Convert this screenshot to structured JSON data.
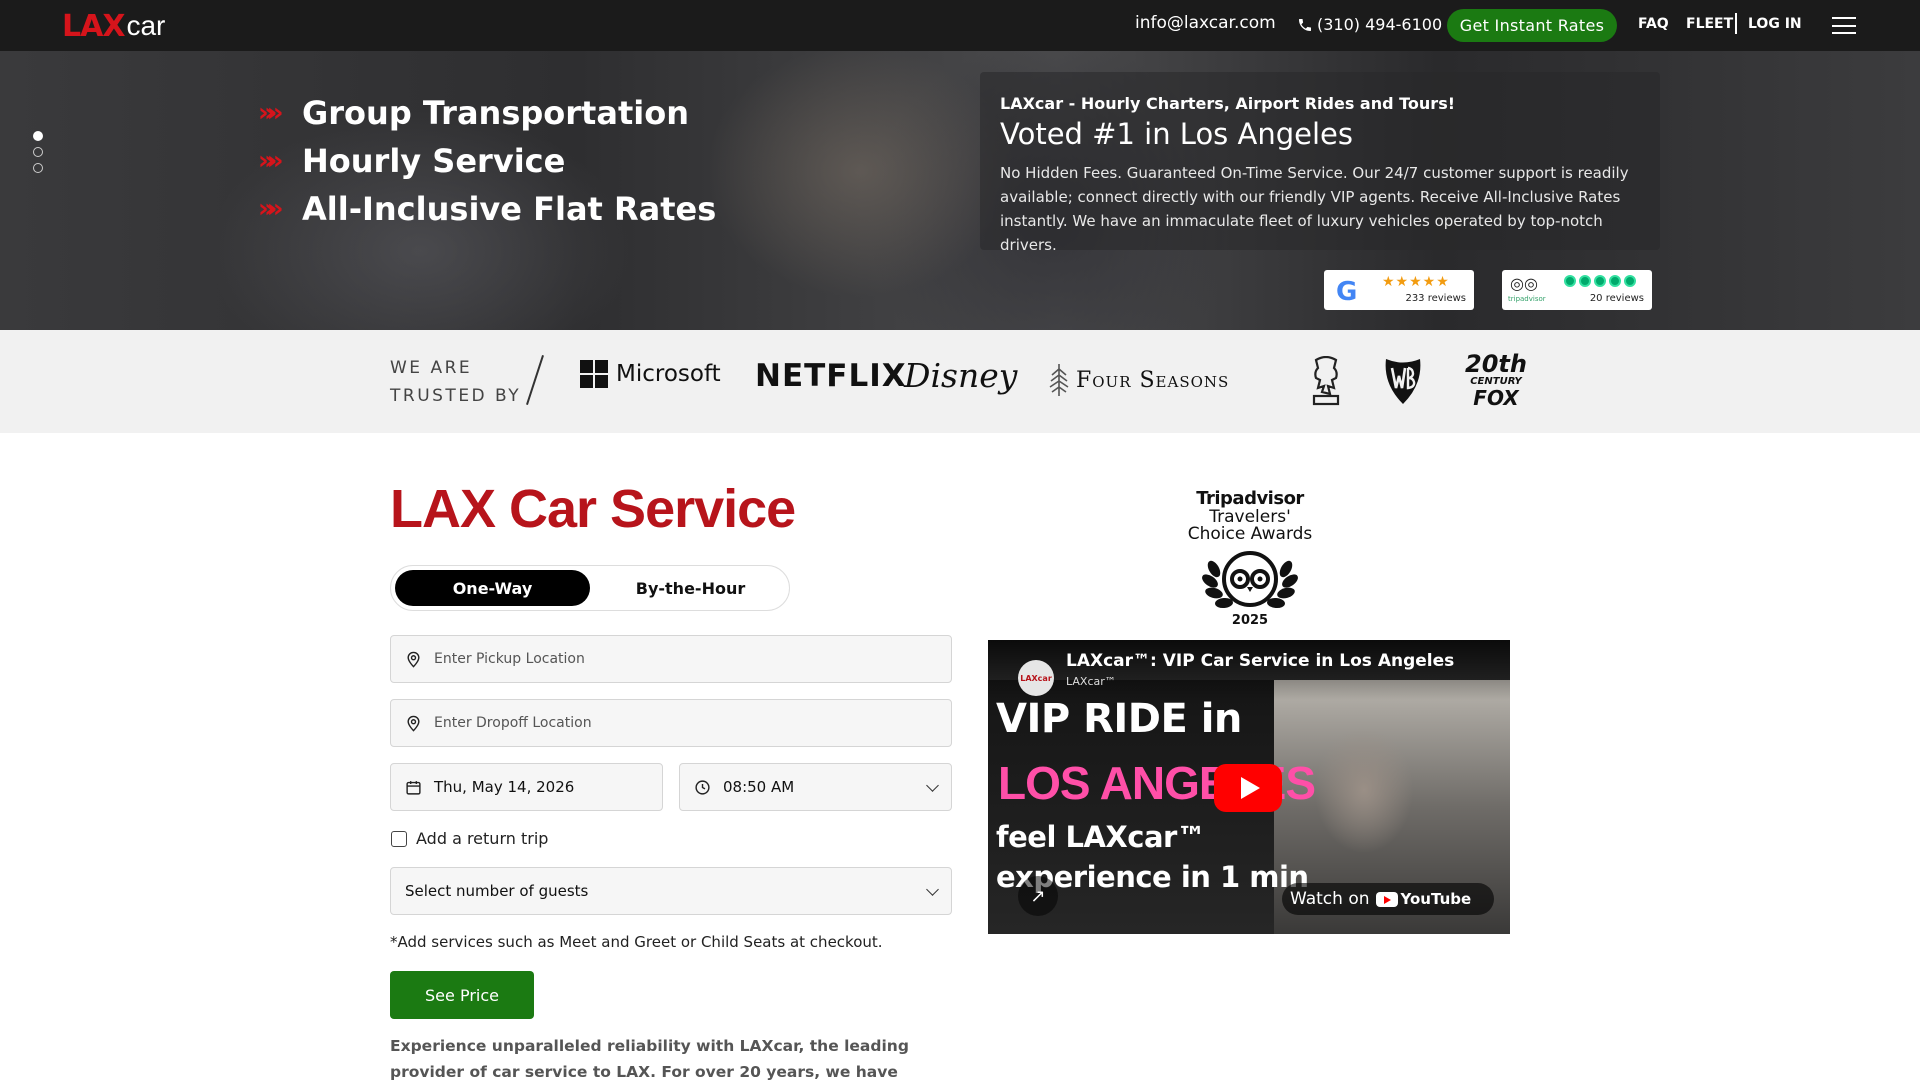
{
  "header": {
    "logo_lax": "LAX",
    "logo_car": "car",
    "email": "info@laxcar.com",
    "phone": "(310) 494-6100",
    "cta_label": "Get Instant Rates",
    "nav": {
      "faq": "FAQ",
      "fleet": "FLEET",
      "login": "LOG IN"
    }
  },
  "hero": {
    "bullets": [
      "Group Transportation",
      "Hourly Service",
      "All-Inclusive Flat Rates"
    ],
    "bullet_marker": "»»",
    "carousel_active_index": 0,
    "promo": {
      "subtitle": "LAXcar - Hourly Charters, Airport Rides and Tours!",
      "headline": "Voted #1 in Los Angeles",
      "description": "No Hidden Fees. Guaranteed On-Time Service. Our 24/7 customer support is readily available; connect directly with our friendly VIP agents. Receive All-Inclusive Rates instantly. We have an immaculate fleet of luxury vehicles operated by top-notch drivers."
    },
    "reviews": {
      "google": {
        "logo": "G",
        "rating": 5,
        "stars": "★★★★★",
        "count_label": "233 reviews"
      },
      "tripadvisor": {
        "logo": "◎◎",
        "wordmark": "tripadvisor",
        "rating": 5,
        "count_label": "20 reviews"
      }
    }
  },
  "trusted": {
    "label_line1": "WE ARE",
    "label_line2": "TRUSTED BY",
    "brands": {
      "microsoft": "Microsoft",
      "netflix": "NETFLIX",
      "disney": "Disney",
      "four_seasons": "Four Seasons",
      "fox_line1": "20th",
      "fox_line2": "CENTURY",
      "fox_line3": "FOX"
    }
  },
  "booking": {
    "title": "LAX Car Service",
    "modes": {
      "one_way": "One-Way",
      "by_hour": "By-the-Hour",
      "active": "One-Way"
    },
    "pickup_placeholder": "Enter Pickup Location",
    "dropoff_placeholder": "Enter Dropoff Location",
    "date_value": "Thu, May 14, 2026",
    "time_value": "08:50 AM",
    "return_trip_label": "Add a return trip",
    "guests_placeholder": "Select number of guests",
    "note": "*Add services such as Meet and Greet or Child Seats at checkout.",
    "submit_label": "See Price",
    "intro_text": "Experience unparalleled reliability with LAXcar, the leading provider of car service to LAX. For over 20 years, we have excelled in offering a"
  },
  "award": {
    "line1": "Tripadvisor",
    "line2": "Travelers'",
    "line3": "Choice Awards",
    "year": "2025"
  },
  "video": {
    "channel_avatar": "LAXcar",
    "title": "LAXcar™: VIP Car Service in Los Angeles",
    "channel": "LAXcar™",
    "overlay_line1": "VIP RIDE in",
    "overlay_line2": "LOS ANGELES",
    "overlay_line3": "feel LAXcar™",
    "overlay_line4": "experience in 1 min",
    "watch_on": "Watch on",
    "youtube": "YouTube"
  },
  "colors": {
    "brand_red": "#b7141b",
    "cta_green": "#1b7a12",
    "header_bg": "#1b1b1b"
  }
}
